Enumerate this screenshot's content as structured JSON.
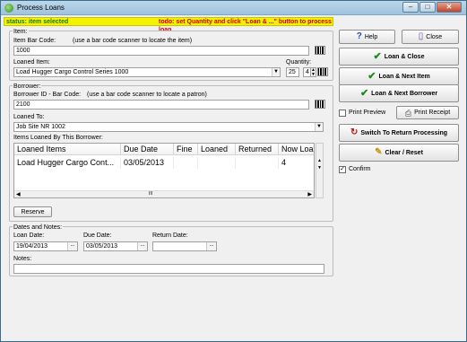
{
  "window": {
    "title": "Process Loans"
  },
  "status": {
    "left": "status: item selected",
    "right": "todo: set Quantity and click \"Loan & ...\" button to process loan"
  },
  "item": {
    "group_label": "Item:",
    "barcode_label": "Item Bar Code:",
    "barcode_hint": "(use a bar code scanner to locate the item)",
    "barcode_value": "1000",
    "loaned_label": "Loaned Item:",
    "loaned_value": "Load Hugger Cargo Control Series 1000",
    "quantity_label": "Quantity:",
    "quantity_value": "25",
    "quantity_selected": "4"
  },
  "borrower": {
    "group_label": "Borrower:",
    "barcode_label": "Borrower ID - Bar Code:",
    "barcode_hint": "(use a bar code scanner to locate a patron)",
    "barcode_value": "2100",
    "loaned_to_label": "Loaned To:",
    "loaned_to_value": "Job Site NR 1002",
    "items_label": "Items Loaned By This Borrower:",
    "columns": [
      "Loaned Items",
      "Due Date",
      "Fine",
      "Loaned",
      "Returned",
      "Now Loa"
    ],
    "rows": [
      [
        "Load Hugger Cargo Cont...",
        "03/05/2013",
        "",
        "",
        "",
        "4"
      ]
    ],
    "scroll_marker": "III",
    "reserve_label": "Reserve"
  },
  "dates": {
    "group_label": "Dates and Notes:",
    "loan_label": "Loan Date:",
    "loan_value": "19/04/2013",
    "due_label": "Due Date:",
    "due_value": "03/05/2013",
    "return_label": "Return Date:",
    "return_value": "",
    "notes_label": "Notes:",
    "notes_value": "",
    "date_btn": "..."
  },
  "actions": {
    "help": "Help",
    "close": "Close",
    "loan_close": "Loan & Close",
    "loan_next_item": "Loan & Next Item",
    "loan_next_borrower": "Loan & Next Borrower",
    "print_preview": "Print Preview",
    "print_receipt": "Print Receipt",
    "switch_return": "Switch To Return Processing",
    "clear_reset": "Clear / Reset",
    "confirm": "Confirm"
  },
  "colors": {
    "status_bg": "#f5f200",
    "status_ok": "#1a7a1a",
    "status_todo": "#d00000",
    "check_green": "#1d8a1d"
  }
}
